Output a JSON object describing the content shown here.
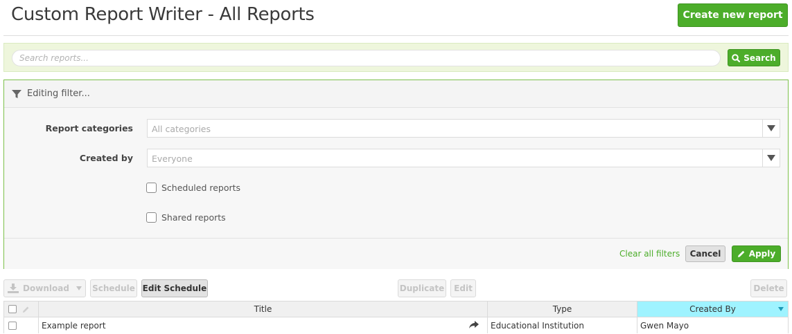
{
  "header": {
    "title": "Custom Report Writer - All Reports",
    "create_button": "Create new report"
  },
  "search": {
    "placeholder": "Search reports...",
    "button_label": "Search"
  },
  "filter": {
    "header_label": "Editing filter...",
    "categories_label": "Report categories",
    "categories_value": "All categories",
    "created_by_label": "Created by",
    "created_by_value": "Everyone",
    "scheduled_label": "Scheduled reports",
    "shared_label": "Shared reports",
    "clear_label": "Clear all filters",
    "cancel_label": "Cancel",
    "apply_label": "Apply"
  },
  "toolbar": {
    "download_label": "Download",
    "schedule_label": "Schedule",
    "edit_schedule_label": "Edit Schedule",
    "duplicate_label": "Duplicate",
    "edit_label": "Edit",
    "delete_label": "Delete"
  },
  "table": {
    "columns": [
      "Title",
      "Type",
      "Created By"
    ],
    "sorted_column": "Created By",
    "rows": [
      {
        "title": "Example report",
        "type": "Educational Institution",
        "created_by": "Gwen Mayo"
      }
    ]
  },
  "colors": {
    "accent_green": "#4cad2a",
    "search_band": "#eef6dc",
    "sorted_header": "#9ff3ff"
  },
  "icons": [
    "filter-icon",
    "search-icon",
    "pencil-icon",
    "download-icon",
    "chevron-down-icon",
    "share-arrow-icon"
  ]
}
